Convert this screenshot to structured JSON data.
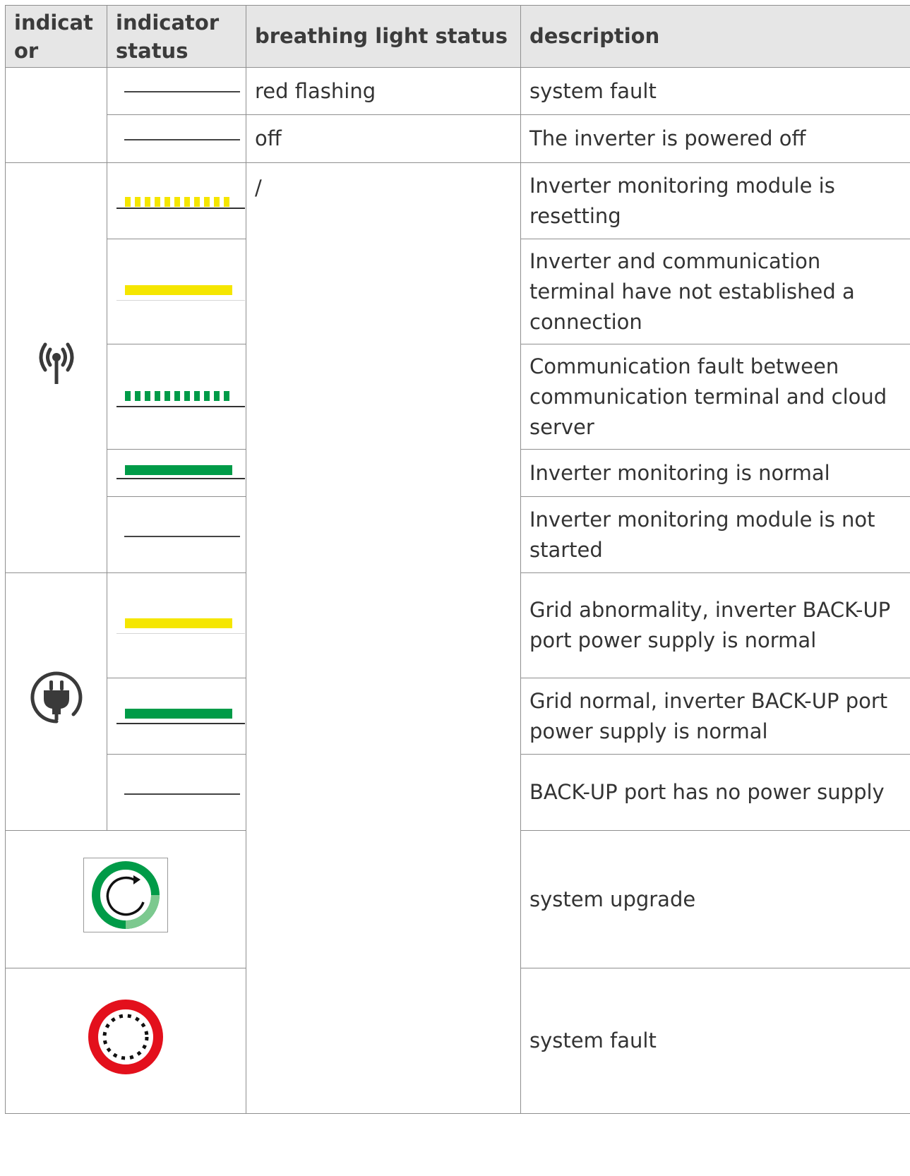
{
  "table": {
    "headers": [
      "indicat or",
      "indicator status",
      "breathing light status",
      "description"
    ],
    "rows": {
      "r1": {
        "breathing": "red flashing",
        "description": "system fault"
      },
      "r2": {
        "breathing": "off",
        "description": "The inverter is powered off"
      },
      "r3": {
        "breathing": "/",
        "description": "Inverter monitoring module is resetting"
      },
      "r4": {
        "description": "Inverter and communication terminal have not established a connection"
      },
      "r5": {
        "description": "Communication fault between communication terminal and cloud server"
      },
      "r6": {
        "description": "Inverter monitoring is normal"
      },
      "r7": {
        "description": "Inverter monitoring module is not started"
      },
      "r8": {
        "description": "Grid abnormality, inverter BACK-UP port power supply is normal"
      },
      "r9": {
        "description": "Grid normal, inverter BACK-UP port power supply is normal"
      },
      "r10": {
        "description": "BACK-UP port has no power supply"
      },
      "r11": {
        "description": "system upgrade"
      },
      "r12": {
        "description": "system fault"
      }
    }
  },
  "icons": {
    "communication": "antenna-signal-icon",
    "grid": "power-plug-icon",
    "upgrade": "circular-refresh-icon",
    "fault": "red-ring-dotted-icon"
  },
  "colors": {
    "yellow": "#f5e600",
    "green": "#009b48",
    "red": "#e3101c",
    "header_bg": "#e6e6e6"
  }
}
